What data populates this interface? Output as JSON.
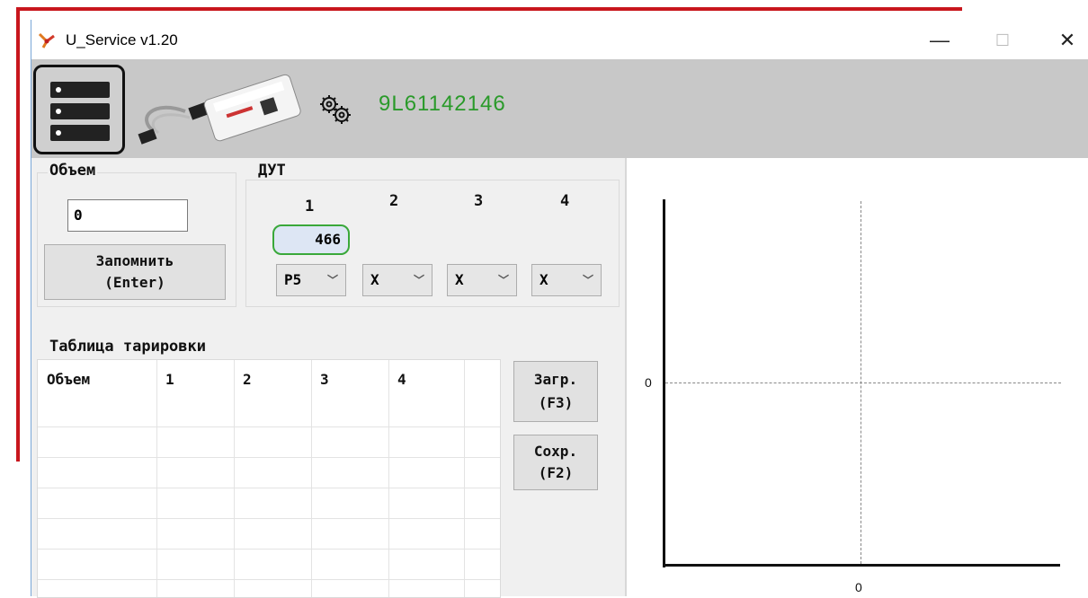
{
  "window": {
    "title": "U_Service v1.20",
    "minimize": "—",
    "maximize": "☐",
    "close": "✕"
  },
  "toolbar": {
    "serial": "9L61142146",
    "icons": [
      "server-icon",
      "device-image",
      "gears-icon"
    ],
    "serial_color": "#2a9a2a"
  },
  "volume": {
    "group_label": "Объем",
    "value": "0",
    "save_button": "Запомнить\n(Enter)"
  },
  "dut": {
    "group_label": "ДУТ",
    "columns": [
      "1",
      "2",
      "3",
      "4"
    ],
    "value_1": "466",
    "selects": [
      "P5",
      "X",
      "X",
      "X"
    ]
  },
  "calibration": {
    "group_label": "Таблица тарировки",
    "headers": [
      "Объем",
      "1",
      "2",
      "3",
      "4"
    ],
    "load_button": "Загр.\n(F3)",
    "save_button": "Сохр.\n(F2)"
  },
  "chart": {
    "y_tick": "0",
    "x_tick": "0"
  }
}
